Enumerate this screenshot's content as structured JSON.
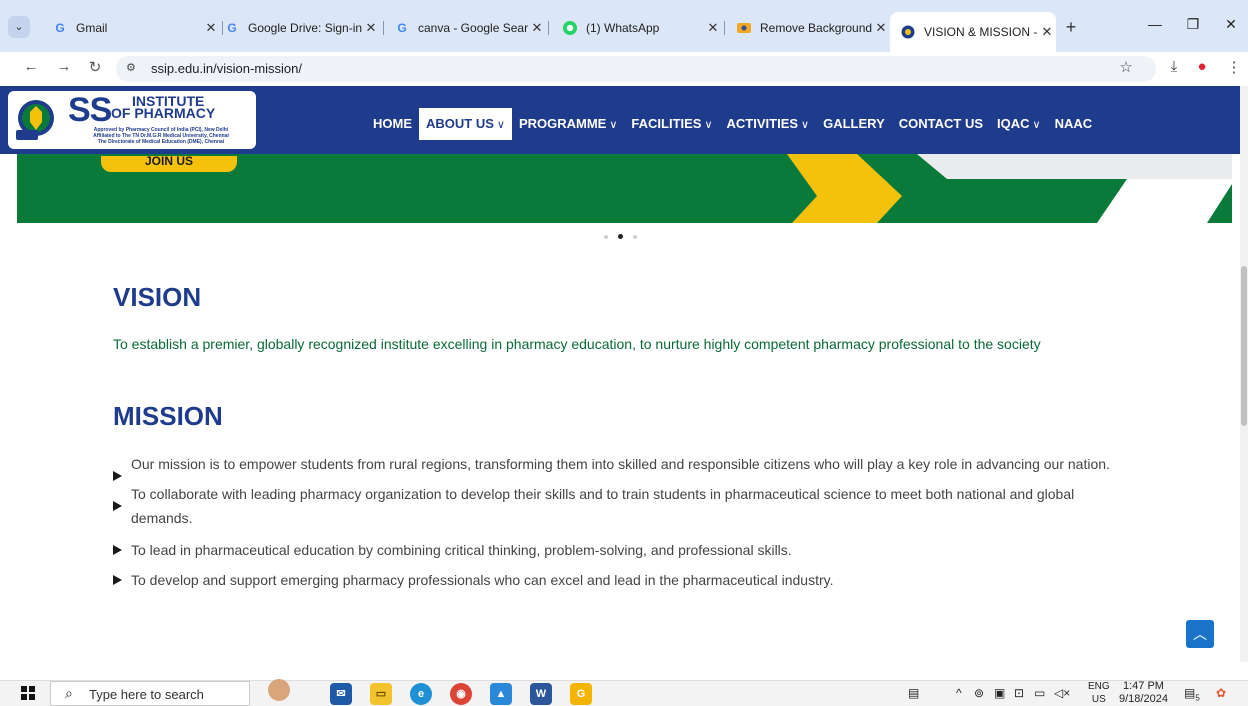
{
  "browser": {
    "tabs": [
      {
        "title": "Gmail",
        "icon": "google-icon",
        "color": "#4285f4"
      },
      {
        "title": "Google Drive: Sign-in",
        "icon": "google-icon",
        "color": "#4285f4"
      },
      {
        "title": "canva - Google Searc",
        "icon": "google-icon",
        "color": "#4285f4"
      },
      {
        "title": "(1) WhatsApp",
        "icon": "whatsapp-icon",
        "color": "#25d366"
      },
      {
        "title": "Remove Background",
        "icon": "removebg-icon",
        "color": "#f4a623"
      },
      {
        "title": "VISION & MISSION -",
        "icon": "ssip-icon",
        "color": "#1f3b8c",
        "active": true
      }
    ],
    "url": "ssip.edu.in/vision-mission/"
  },
  "site": {
    "logo": {
      "ss": "SS",
      "institute": "INSTITUTE",
      "of_pharmacy": "OF PHARMACY",
      "approval_lines": [
        "Approved by Pharmacy Council of India (PCI), New Delhi",
        "Affiliated to The TN Dr.M.G.R Medical University, Chennai",
        "The Directorate of Medical Education (DME), Chennai"
      ],
      "seal_text": "SSIP"
    },
    "menu": [
      {
        "label": "HOME",
        "chevron": false
      },
      {
        "label": "ABOUT US",
        "chevron": true,
        "active": true
      },
      {
        "label": "PROGRAMME",
        "chevron": true
      },
      {
        "label": "FACILITIES",
        "chevron": true
      },
      {
        "label": "ACTIVITIES",
        "chevron": true
      },
      {
        "label": "GALLERY",
        "chevron": false
      },
      {
        "label": "CONTACT US",
        "chevron": false
      },
      {
        "label": "IQAC",
        "chevron": true
      },
      {
        "label": "NAAC",
        "chevron": false
      }
    ],
    "banner_button": "JOIN US",
    "slider": {
      "count": 3,
      "active_index": 1
    }
  },
  "content": {
    "vision_heading": "VISION",
    "vision_text": "To establish a premier, globally recognized institute excelling in pharmacy education, to nurture highly competent pharmacy professional to the society",
    "mission_heading": "MISSION",
    "mission_items": [
      "Our mission is to empower students from rural regions, transforming them into skilled and responsible citizens who will play a key role in advancing our nation.",
      "To collaborate with leading pharmacy organization to develop their skills and to train students in pharmaceutical science to meet both national and global demands.",
      "To lead in pharmaceutical education by combining critical thinking, problem-solving, and professional skills.",
      "To develop and support emerging pharmacy professionals who can excel and lead in the pharmaceutical industry."
    ]
  },
  "taskbar": {
    "search_placeholder": "Type here to search",
    "lang_top": "ENG",
    "lang_bottom": "US",
    "time": "1:47 PM",
    "date": "9/18/2024",
    "notification_count": "5"
  },
  "colors": {
    "brand_blue": "#1f3b8c",
    "green": "#0a7a3a",
    "yellow": "#f4c20d",
    "text_green": "#0a6a37"
  }
}
